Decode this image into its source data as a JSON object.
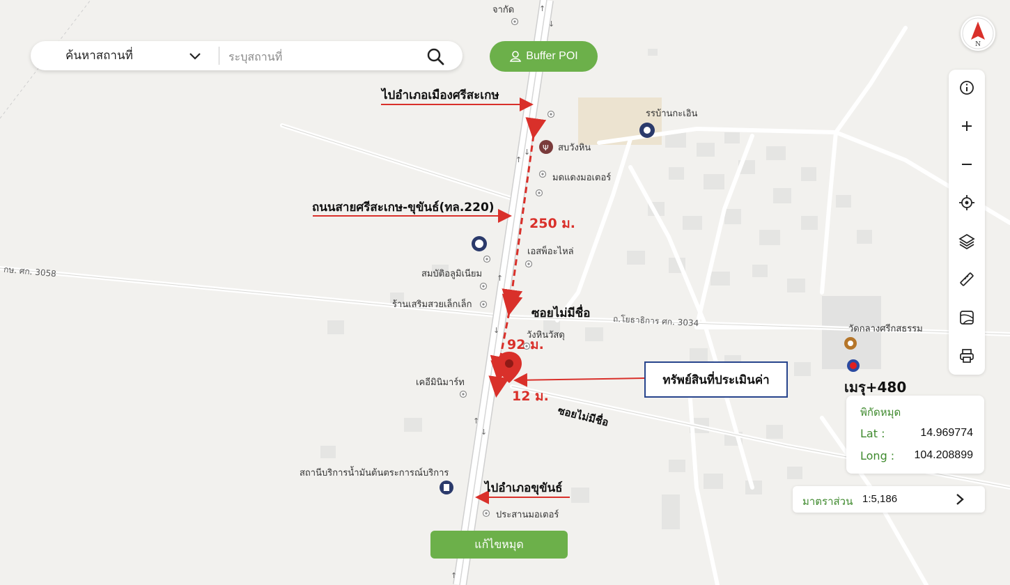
{
  "search": {
    "mode_label": "ค้นหาสถานที่",
    "placeholder": "ระบุสถานที่"
  },
  "buffer_button": {
    "label": "Buffer POI"
  },
  "compass": {
    "label": "N"
  },
  "toolbar": {
    "icons": [
      "info-icon",
      "zoom-in-icon",
      "zoom-out-icon",
      "locate-icon",
      "layers-icon",
      "ruler-icon",
      "map-style-icon",
      "print-icon"
    ]
  },
  "map_labels": {
    "top_place": "จากัด",
    "school": "รรบ้านกะเอิน",
    "restaurant": "สบวังหิน",
    "motor_shop": "มดแดงมอเตอร์",
    "parts_shop": "เอสพ็อะไหล่",
    "aluminium": "สมบัติอลูมิเนียม",
    "beauty": "ร้านเสริมสวยเล็กเล็ก",
    "materials": "วังหินวัสดุ",
    "mart": "เคอีมินิมาร์ท",
    "gas_station": "สถานีบริการน้ำมันต้นตระการณ์บริการ",
    "motor2": "ประสานมอเตอร์",
    "temple": "วัดกลางศรีกสธรรม",
    "road_left": "กษ. ศก. 3058",
    "road_right": "ถ.โยธาธิการ ศก. 3034"
  },
  "annotations": {
    "to_sisaket": "ไปอำเภอเมืองศรีสะเกษ",
    "main_road": "ถนนสายศรีสะเกษ-ขุขันธ์(ทล.220)",
    "soi_unnamed_1": "ซอยไม่มีชื่อ",
    "soi_unnamed_2": "ซอยไม่มีชื่อ",
    "to_khukhan": "ไปอำเภอขุขันธ์",
    "asset": "ทรัพย์สินที่ประเมินค่า",
    "dist_250": "250 ม.",
    "dist_92": "92 ม.",
    "dist_12": "12 ม."
  },
  "location_name": "เมรุ+480",
  "coordinates": {
    "title": "พิกัดหมุด",
    "lat_label": "Lat :",
    "lat_value": "14.969774",
    "long_label": "Long :",
    "long_value": "104.208899"
  },
  "scale": {
    "label": "มาตราส่วน",
    "value": "1:5,186"
  },
  "edit_button": {
    "label": "แก้ไขหมุด"
  },
  "colors": {
    "accent_green": "#6cb04a",
    "annotation_red": "#d9302a",
    "box_navy": "#27448c"
  }
}
